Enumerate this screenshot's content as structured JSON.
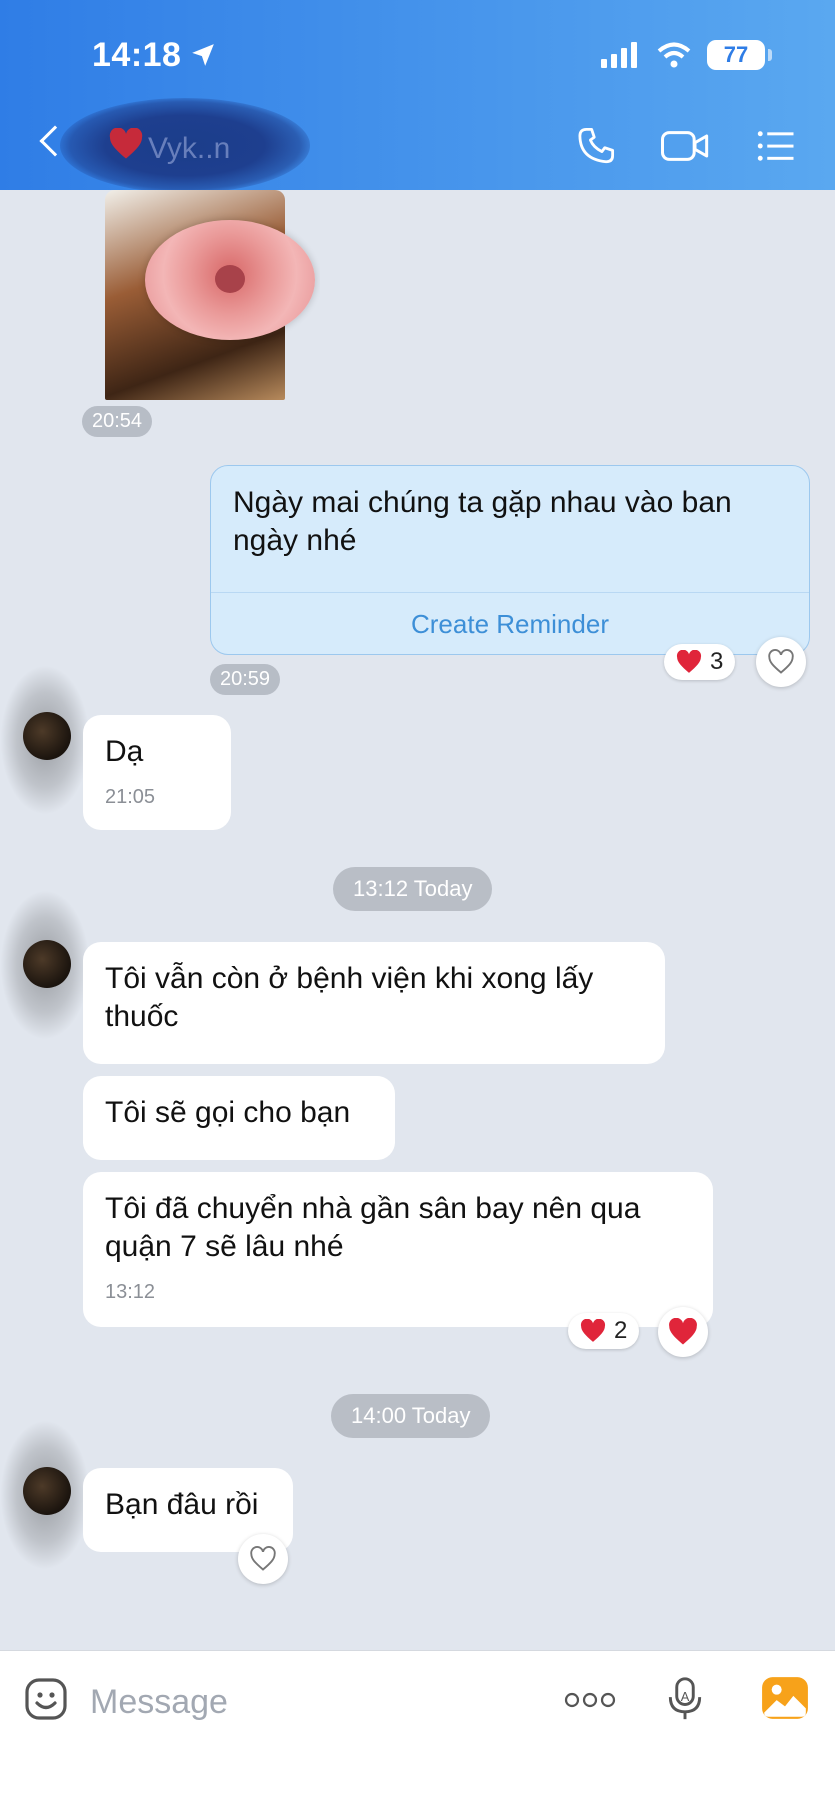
{
  "status_bar": {
    "time": "14:18",
    "battery": "77"
  },
  "header": {
    "contact_name": "Vyk..n"
  },
  "messages": {
    "sticker_time": "20:54",
    "out_text": "Ngày mai chúng ta gặp nhau vào ban ngày nhé",
    "create_reminder": "Create Reminder",
    "out_time": "20:59",
    "out_reaction_count": "3",
    "in1_text": "Dạ",
    "in1_time": "21:05",
    "date_sep1": "13:12 Today",
    "in2_text": "Tôi vẫn còn ở bệnh viện khi xong lấy thuốc",
    "in3_text": "Tôi sẽ gọi cho bạn",
    "in4_text": "Tôi đã chuyển nhà gần sân bay nên qua quận 7 sẽ lâu nhé",
    "in4_time": "13:12",
    "in4_reaction_count": "2",
    "date_sep2": "14:00 Today",
    "in5_text": "Bạn đâu rồi"
  },
  "composer": {
    "placeholder": "Message"
  },
  "colors": {
    "accent": "#3d8fd7",
    "header_start": "#2f7de6",
    "header_end": "#5aa8f0",
    "heart": "#e0253a"
  }
}
